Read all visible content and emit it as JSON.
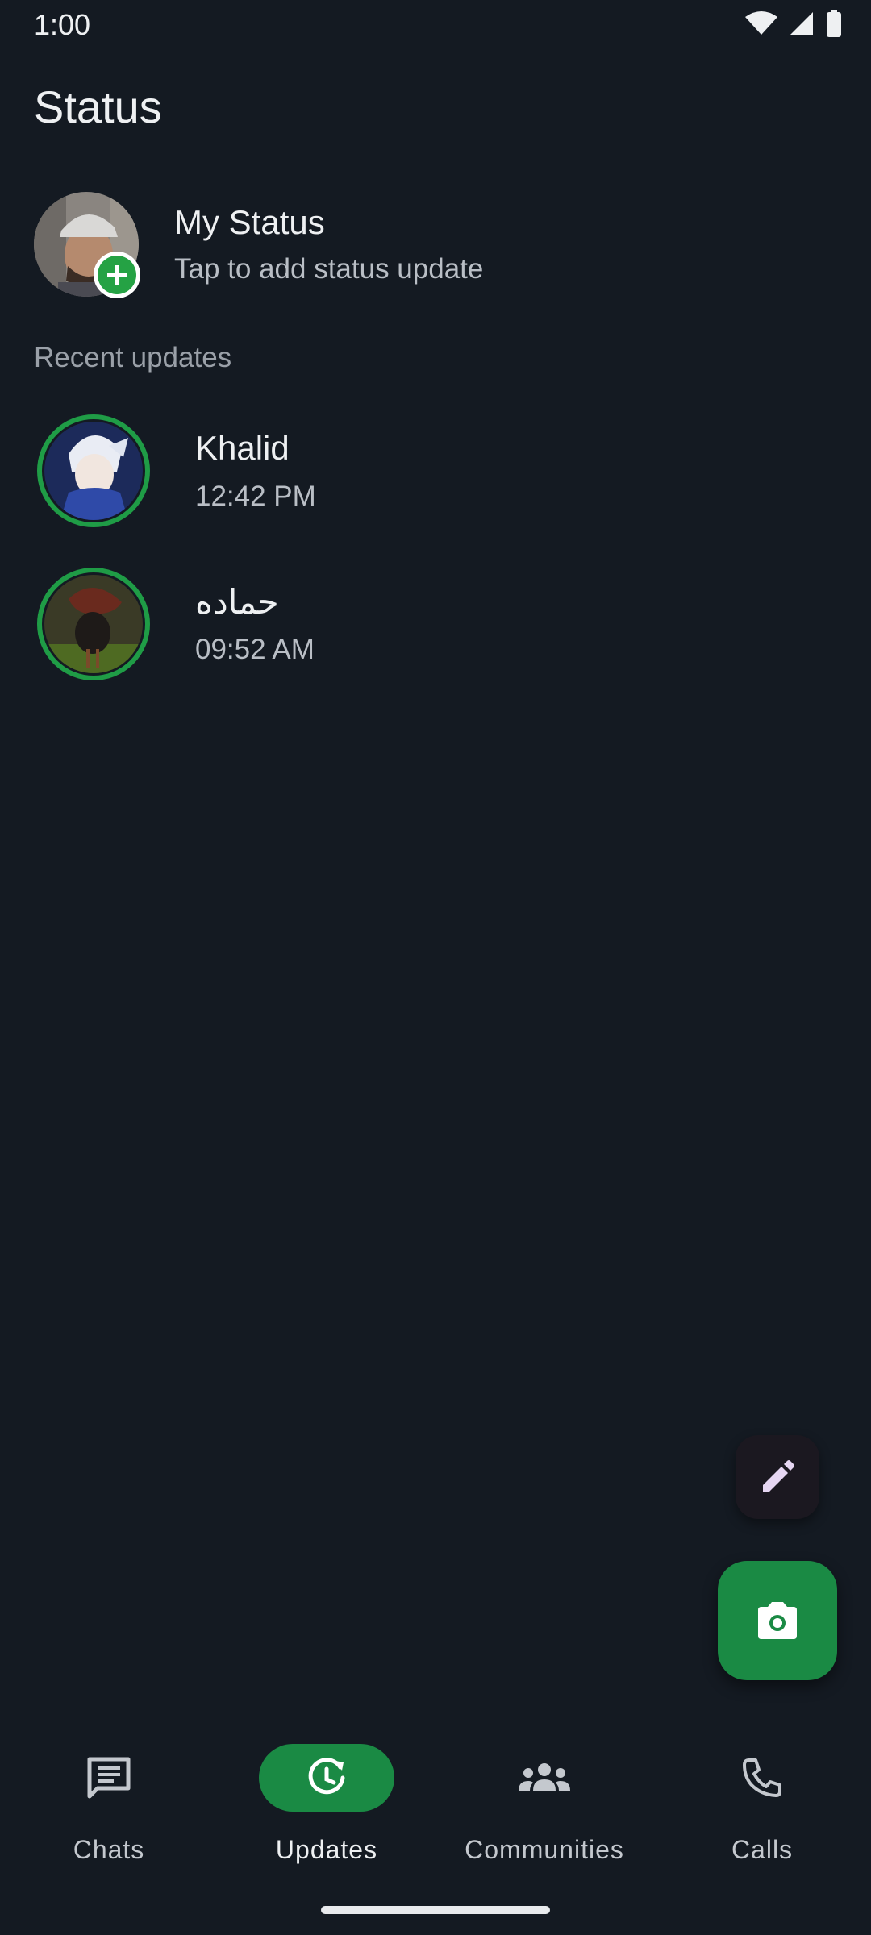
{
  "status_bar": {
    "time": "1:00",
    "icons": [
      "wifi-icon",
      "signal-icon",
      "battery-icon"
    ]
  },
  "page": {
    "title": "Status"
  },
  "my_status": {
    "name": "My Status",
    "subtitle": "Tap to add status update"
  },
  "recent": {
    "label": "Recent updates",
    "items": [
      {
        "name": "Khalid",
        "time": "12:42 PM"
      },
      {
        "name": "حماده",
        "time": "09:52 AM"
      }
    ]
  },
  "fabs": {
    "edit_icon": "pencil-icon",
    "camera_icon": "camera-icon"
  },
  "bottom_nav": {
    "items": [
      {
        "label": "Chats",
        "icon": "chat-icon",
        "active": false
      },
      {
        "label": "Updates",
        "icon": "updates-icon",
        "active": true
      },
      {
        "label": "Communities",
        "icon": "communities-icon",
        "active": false
      },
      {
        "label": "Calls",
        "icon": "phone-icon",
        "active": false
      }
    ]
  },
  "colors": {
    "background": "#141a22",
    "accent_green": "#1a8a44",
    "ring_green": "#1f9c46"
  }
}
